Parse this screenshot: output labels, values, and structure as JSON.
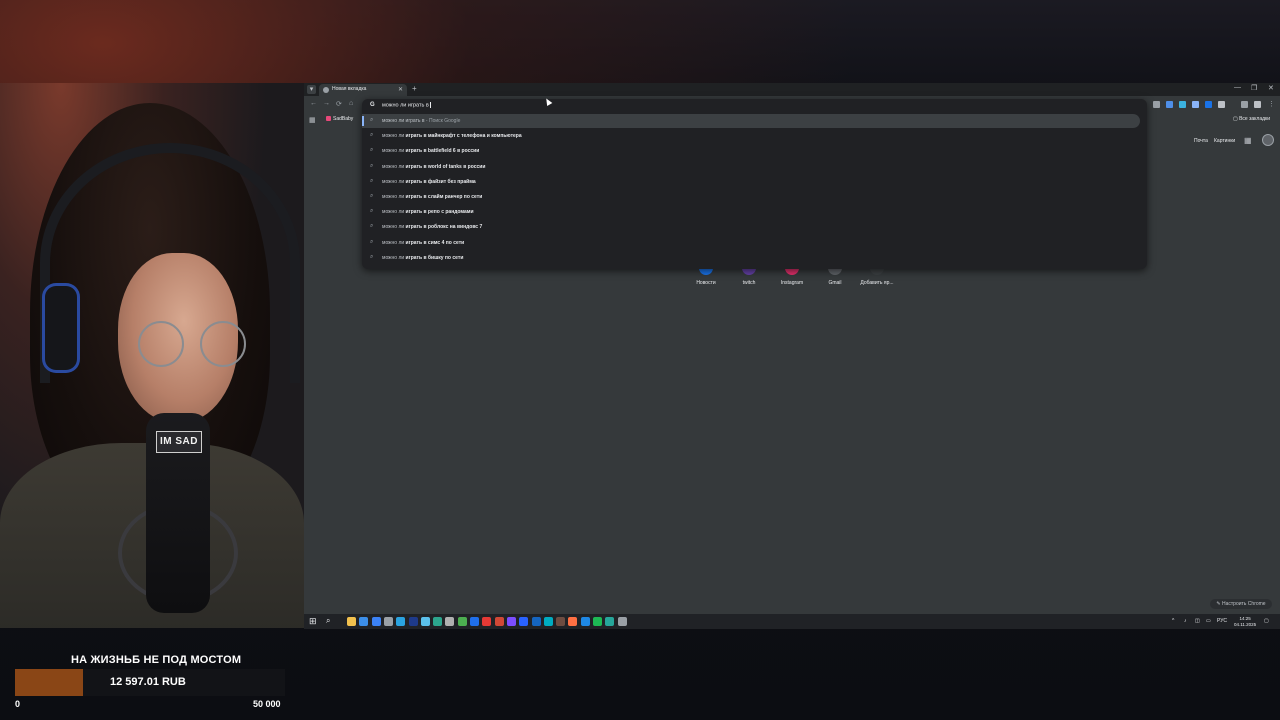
{
  "browser": {
    "tab_title": "Новая вкладка",
    "new_tab_label": "+",
    "omnibox_value": "можно ли играть в",
    "bookmark_label": "SadBaby",
    "all_bookmarks_label": "Все закладки",
    "top_links": [
      "Почта",
      "Картинки"
    ],
    "customize_label": "Настроить Chrome"
  },
  "suggestions": [
    {
      "prefix": "можно ли играть в",
      "rest": "",
      "meta": " - Поиск Google"
    },
    {
      "prefix": "можно ли",
      "rest": " играть в майнкрафт с телефона и компьютера",
      "meta": ""
    },
    {
      "prefix": "можно ли",
      "rest": " играть в battlefield 6 в россии",
      "meta": ""
    },
    {
      "prefix": "можно ли",
      "rest": " играть в world of tanks в россии",
      "meta": ""
    },
    {
      "prefix": "можно ли",
      "rest": " играть в файзит без прайма",
      "meta": ""
    },
    {
      "prefix": "можно ли",
      "rest": " играть в слайм ранчер по сети",
      "meta": ""
    },
    {
      "prefix": "можно ли",
      "rest": " играть в репо с рандомами",
      "meta": ""
    },
    {
      "prefix": "можно ли",
      "rest": " играть в роблокс на виндовс 7",
      "meta": ""
    },
    {
      "prefix": "можно ли",
      "rest": " играть в симс 4 по сети",
      "meta": ""
    },
    {
      "prefix": "можно ли",
      "rest": " играть в бишку по сети",
      "meta": ""
    }
  ],
  "shortcuts": [
    {
      "label": "Новости",
      "color": "#1a73e8"
    },
    {
      "label": "twitch",
      "color": "#6441a5"
    },
    {
      "label": "Instagram",
      "color": "#e1306c"
    },
    {
      "label": "Gmail",
      "color": "#5f6368"
    },
    {
      "label": "Добавить яр...",
      "color": "#3c4043"
    }
  ],
  "taskbar": {
    "language": "РУС",
    "time": "14:25",
    "date": "04.11.2025"
  },
  "webcam": {
    "mic_sticker": "IM SAD"
  },
  "goal": {
    "title": "НА ЖИЗНЬБ НЕ ПОД МОСТОМ",
    "amount": "12 597.01 RUB",
    "min": "0",
    "max": "50 000",
    "progress": 0.25,
    "fill_color": "#8a4616"
  }
}
